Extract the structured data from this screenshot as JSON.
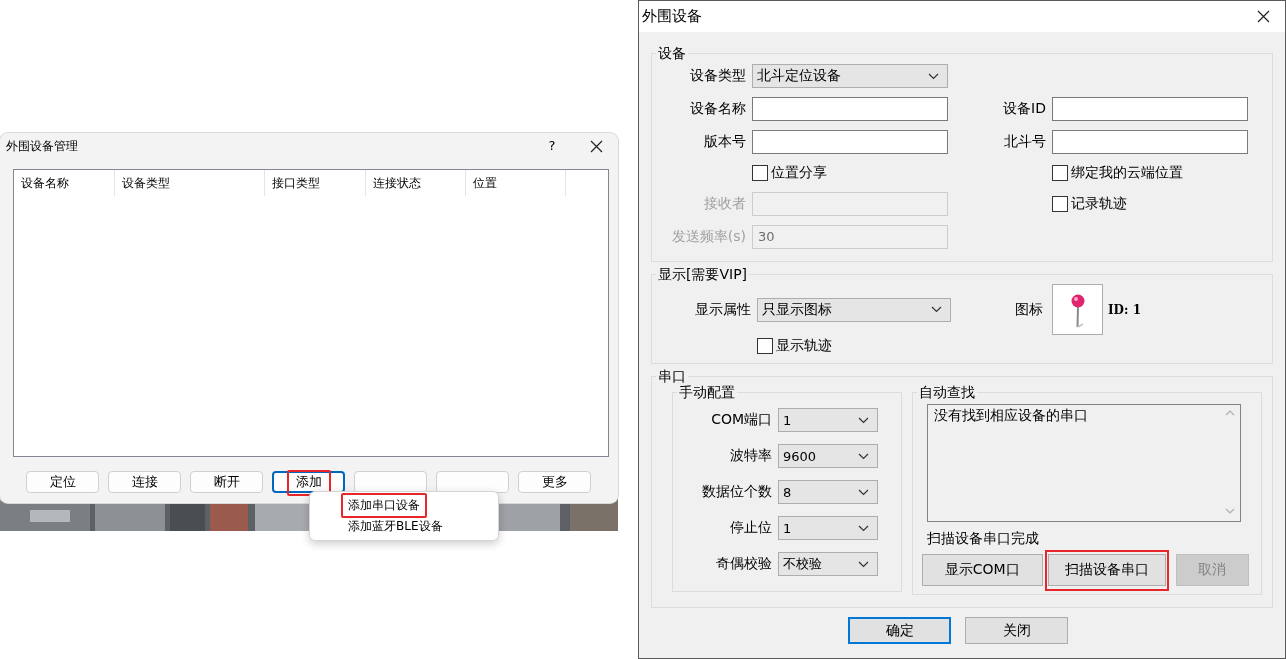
{
  "manager_window": {
    "title": "外围设备管理",
    "help_button": "?",
    "columns": [
      "设备名称",
      "设备类型",
      "接口类型",
      "连接状态",
      "位置"
    ],
    "buttons": [
      {
        "label": "定位",
        "focused": false,
        "highlighted": false
      },
      {
        "label": "连接",
        "focused": false,
        "highlighted": false
      },
      {
        "label": "断开",
        "focused": false,
        "highlighted": false
      },
      {
        "label": "添加",
        "focused": true,
        "highlighted": true
      },
      {
        "focused": false,
        "highlighted": false
      },
      {
        "focused": false,
        "highlighted": false
      },
      {
        "label": "更多",
        "focused": false,
        "highlighted": false
      }
    ],
    "context_menu": [
      {
        "label": "添加串口设备",
        "highlighted": true
      },
      {
        "label": "添加蓝牙BLE设备",
        "highlighted": false
      }
    ],
    "backdrop": {
      "kind": "picture"
    }
  },
  "device_window": {
    "title": "外围设备",
    "device_group": {
      "title": "设备",
      "left": [
        {
          "kind": "select",
          "label": "设备类型",
          "value": "北斗定位设备"
        },
        {
          "kind": "field",
          "label": "设备名称",
          "disabled": false
        },
        {
          "kind": "field",
          "label": "版本号",
          "disabled": false
        },
        {
          "kind": "checkbox",
          "label": "位置分享",
          "checked": false
        },
        {
          "kind": "field",
          "label": "接收者",
          "disabled": true
        },
        {
          "kind": "field",
          "label": "发送频率(s)",
          "value": "30",
          "disabled": true
        }
      ],
      "right": [
        {
          "kind": "field",
          "label": "设备ID",
          "disabled": false
        },
        {
          "kind": "field",
          "label": "北斗号",
          "disabled": false
        },
        {
          "kind": "checkbox",
          "label": "绑定我的云端位置",
          "checked": false
        },
        {
          "kind": "checkbox",
          "label": "记录轨迹",
          "checked": false
        }
      ]
    },
    "display_group": {
      "title": "显示[需要VIP]",
      "display_mode": {
        "label": "显示属性",
        "value": "只显示图标"
      },
      "icon": {
        "label": "图标",
        "id_text": "ID: 1"
      },
      "show_track": {
        "label": "显示轨迹",
        "checked": false
      }
    },
    "serial_group": {
      "title": "串口",
      "manual": {
        "title": "手动配置",
        "fields": [
          {
            "label": "COM端口",
            "value": "1"
          },
          {
            "label": "波特率",
            "value": "9600"
          },
          {
            "label": "数据位个数",
            "value": "8"
          },
          {
            "label": "停止位",
            "value": "1"
          },
          {
            "label": "奇偶校验",
            "value": "不校验"
          }
        ]
      },
      "auto": {
        "title": "自动查找",
        "log": "没有找到相应设备的串口",
        "status": "扫描设备串口完成",
        "buttons": [
          {
            "label": "显示COM口",
            "disabled": false,
            "highlighted": false
          },
          {
            "label": "扫描设备串口",
            "disabled": false,
            "highlighted": true
          },
          {
            "label": "取消",
            "disabled": true,
            "highlighted": false
          }
        ]
      }
    },
    "footer_buttons": [
      {
        "label": "确定",
        "focused": true
      },
      {
        "label": "关闭",
        "focused": false
      }
    ]
  }
}
